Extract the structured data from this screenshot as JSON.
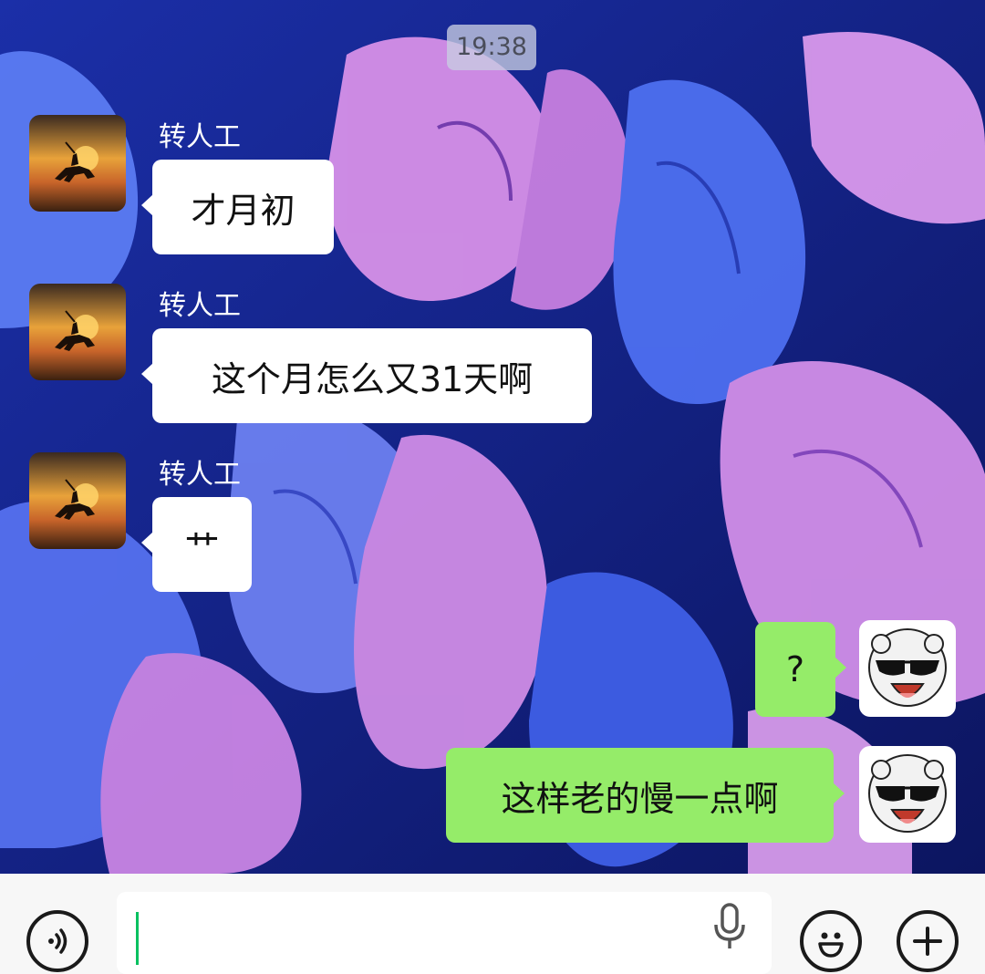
{
  "status": {
    "time": "19:38"
  },
  "messages": [
    {
      "sender": "转人工",
      "text": "才月初",
      "direction": "incoming"
    },
    {
      "sender": "转人工",
      "text": "这个月怎么又31天啊",
      "direction": "incoming"
    },
    {
      "sender": "转人工",
      "text": "艹",
      "direction": "incoming"
    },
    {
      "sender": "",
      "text": "?",
      "direction": "outgoing"
    },
    {
      "sender": "",
      "text": "这样老的慢一点啊",
      "direction": "outgoing"
    }
  ],
  "input_bar": {
    "value": "",
    "voice_icon": "voice-icon",
    "mic_icon": "microphone-icon",
    "emoji_icon": "emoji-icon",
    "plus_icon": "plus-icon"
  },
  "colors": {
    "incoming_bubble": "#ffffff",
    "outgoing_bubble": "#95ec69",
    "cursor": "#07c160",
    "input_bar_bg": "#f7f7f7"
  }
}
